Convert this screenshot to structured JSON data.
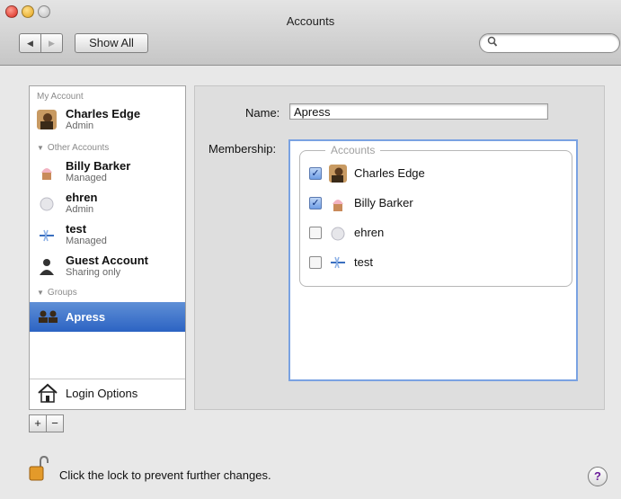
{
  "window": {
    "title": "Accounts"
  },
  "toolbar": {
    "back_icon": "◀",
    "forward_icon": "▶",
    "show_all_label": "Show All",
    "search_value": ""
  },
  "sidebar": {
    "my_account_header": "My Account",
    "my_account": {
      "name": "Charles Edge",
      "role": "Admin"
    },
    "other_accounts_header": "Other Accounts",
    "other_accounts": [
      {
        "name": "Billy Barker",
        "role": "Managed"
      },
      {
        "name": "ehren",
        "role": "Admin"
      },
      {
        "name": "test",
        "role": "Managed"
      },
      {
        "name": "Guest Account",
        "role": "Sharing only"
      }
    ],
    "groups_header": "Groups",
    "groups": [
      {
        "name": "Apress",
        "selected": true
      }
    ],
    "login_options_label": "Login Options",
    "add_label": "+",
    "remove_label": "−"
  },
  "detail": {
    "name_label": "Name:",
    "name_value": "Apress",
    "membership_label": "Membership:",
    "accounts_legend": "Accounts",
    "members": [
      {
        "name": "Charles Edge",
        "checked": true
      },
      {
        "name": "Billy Barker",
        "checked": true
      },
      {
        "name": "ehren",
        "checked": false
      },
      {
        "name": "test",
        "checked": false
      }
    ]
  },
  "footer": {
    "lock_text": "Click the lock to prevent further changes.",
    "help_label": "?"
  },
  "colors": {
    "selection": "#2c63c3",
    "focus_ring": "#7aa2e2"
  }
}
